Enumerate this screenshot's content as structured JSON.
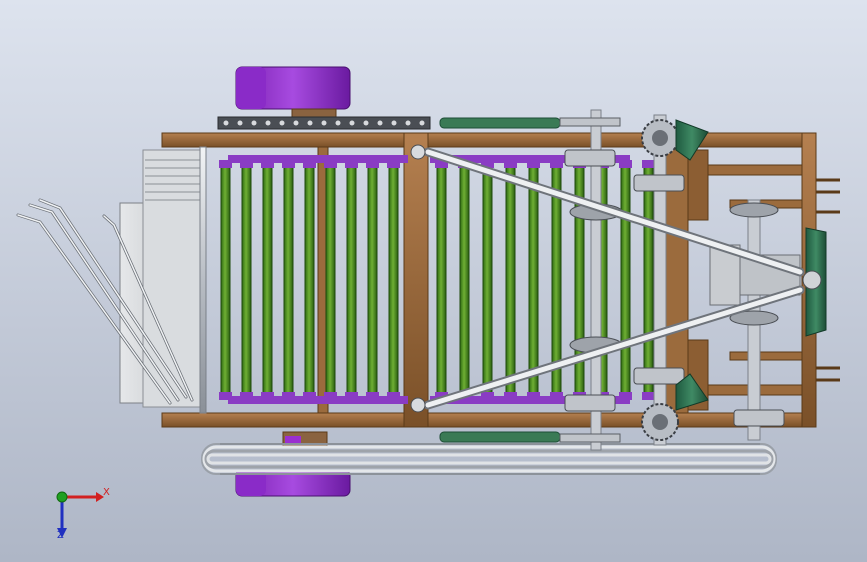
{
  "viewport": {
    "background_top": "#dde3ee",
    "background_bottom": "#aeb6c6"
  },
  "model": {
    "frame_color": "#9b6b3d",
    "roller_color": "#4f8f22",
    "chain_color": "#8a3cc4",
    "wheel_color": "#9a2fd0",
    "shaft_color": "#c9cdd3",
    "belt_color": "#b9bec7",
    "roller_count": 19
  },
  "triad": {
    "x_label": "X",
    "z_label": "Z",
    "x_color": "#d22020",
    "y_color": "#20a020",
    "z_color": "#2030c0"
  }
}
